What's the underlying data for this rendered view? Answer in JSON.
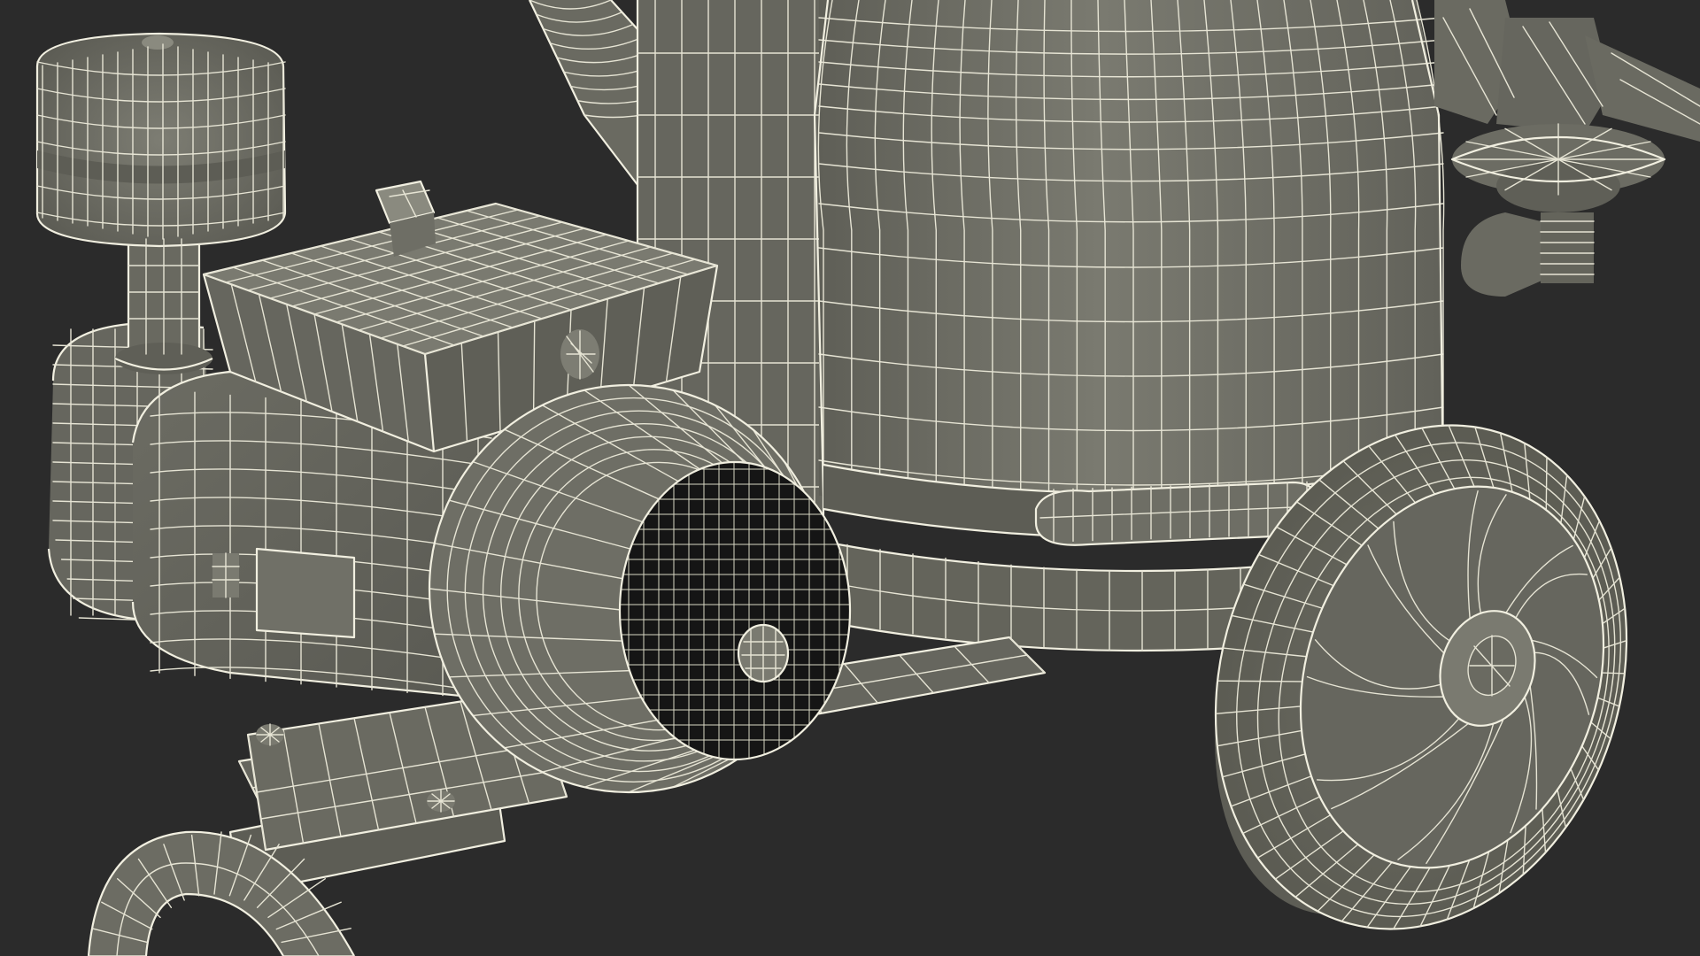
{
  "scene": {
    "kind": "3d-wireframe-render",
    "subject": "paint-sprayer-pump-cart",
    "background_color": "#2b2b2b",
    "surface_color": "#73736a",
    "surface_shadow_color": "#56564f",
    "wire_color": "#e6e4d4",
    "grille_hole_color": "#141414"
  }
}
